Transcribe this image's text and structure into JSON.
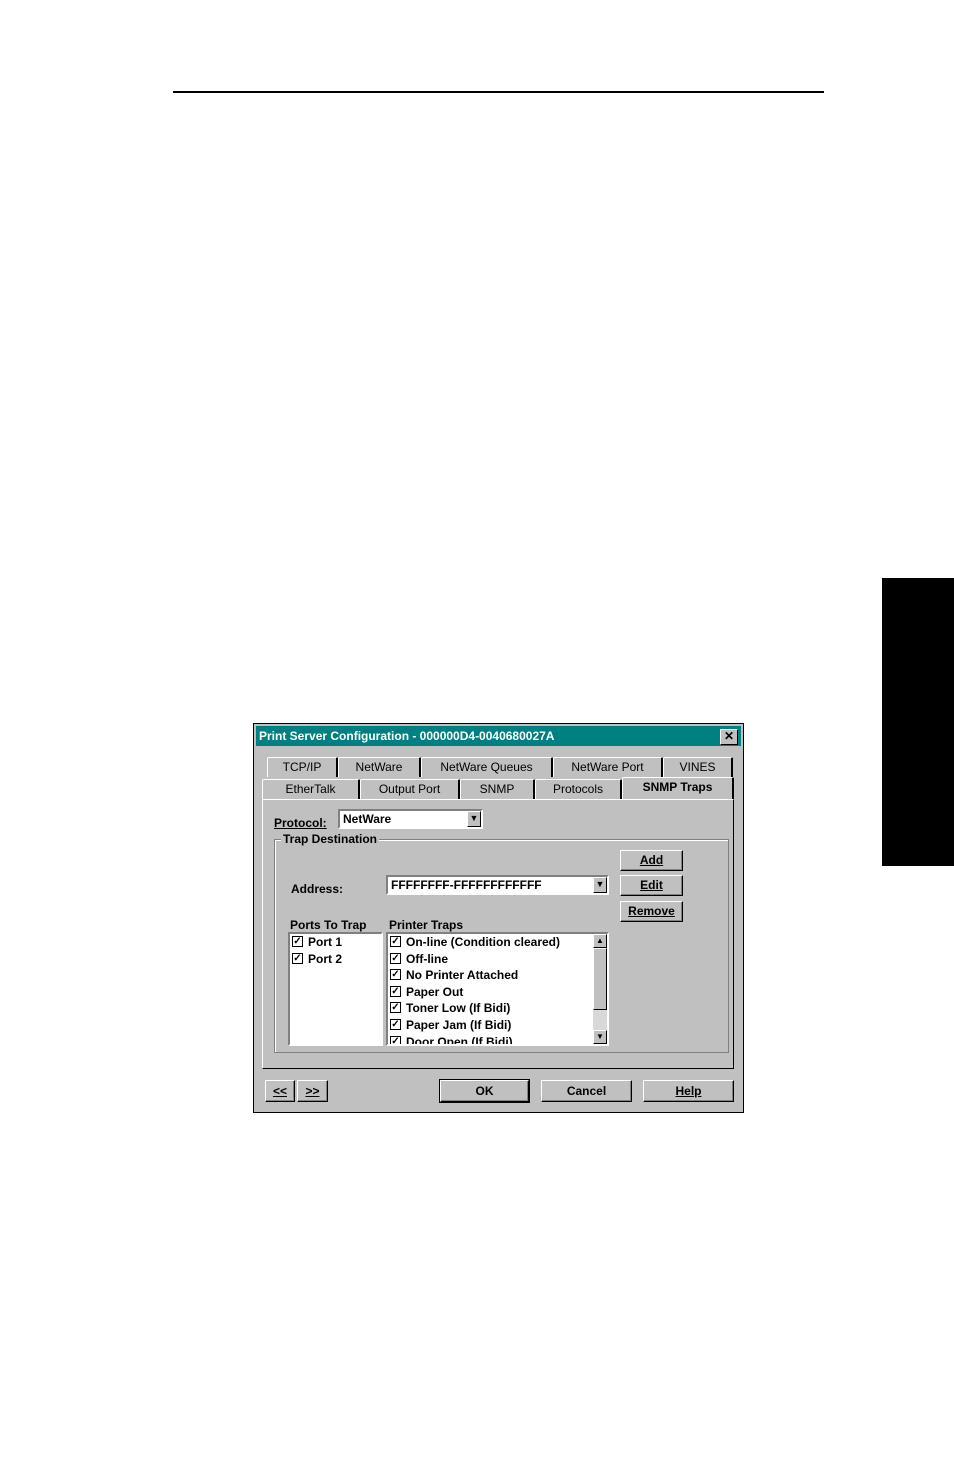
{
  "dialog": {
    "title": "Print Server Configuration - 000000D4-0040680027A",
    "close_glyph": "✕",
    "tabs_row1": [
      "TCP/IP",
      "NetWare",
      "NetWare Queues",
      "NetWare Port",
      "VINES"
    ],
    "tabs_row2": [
      "EtherTalk",
      "Output Port",
      "SNMP",
      "Protocols",
      "SNMP Traps"
    ],
    "active_tab": "SNMP Traps",
    "protocol": {
      "label": "Protocol:",
      "value": "NetWare"
    },
    "trap_destination": {
      "label": "Trap Destination",
      "address_label": "Address:",
      "address_value": "FFFFFFFF-FFFFFFFFFFFF",
      "buttons": {
        "add": "Add",
        "edit": "Edit",
        "remove": "Remove"
      }
    },
    "ports_to_trap": {
      "label": "Ports To Trap",
      "items": [
        {
          "label": "Port 1",
          "checked": true
        },
        {
          "label": "Port 2",
          "checked": true
        }
      ]
    },
    "printer_traps": {
      "label": "Printer Traps",
      "items": [
        {
          "label": "On-line (Condition cleared)",
          "checked": true
        },
        {
          "label": "Off-line",
          "checked": true
        },
        {
          "label": "No Printer Attached",
          "checked": true
        },
        {
          "label": "Paper Out",
          "checked": true
        },
        {
          "label": "Toner Low (If Bidi)",
          "checked": true
        },
        {
          "label": "Paper Jam (If Bidi)",
          "checked": true
        },
        {
          "label": "Door Open (If Bidi)",
          "checked": true
        }
      ]
    },
    "footer": {
      "prev": "<<",
      "next": ">>",
      "ok": "OK",
      "cancel": "Cancel",
      "help": "Help"
    }
  }
}
